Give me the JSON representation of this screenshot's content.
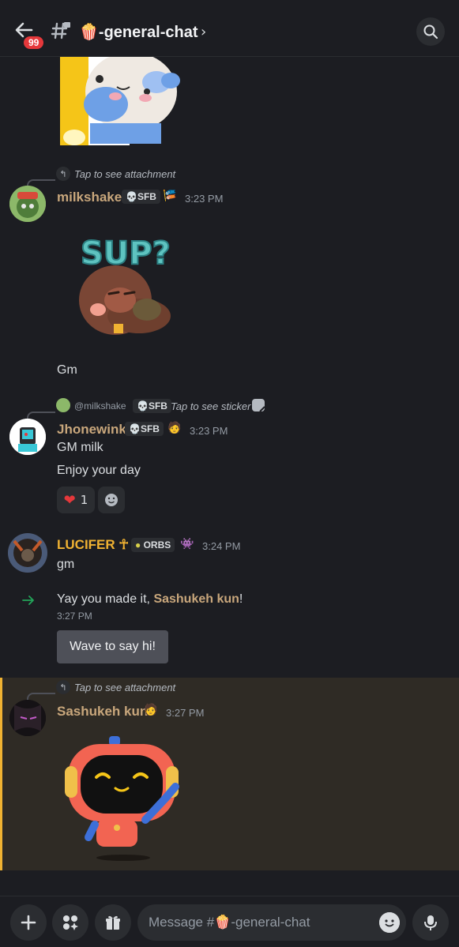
{
  "header": {
    "badge_count": "99",
    "channel_name": "🍿-general-chat",
    "chevron": "›"
  },
  "messages": {
    "reply1": {
      "text": "Tap to see attachment"
    },
    "m1": {
      "username": "milkshake",
      "tag": "SFB",
      "time": "3:23 PM",
      "text": "Gm"
    },
    "reply2": {
      "mention": "@milkshake",
      "tag": "SFB",
      "text": "Tap to see sticker"
    },
    "m2": {
      "username": "Jhonewink",
      "tag": "SFB",
      "time": "3:23 PM",
      "text1": "GM milk",
      "text2": "Enjoy your day",
      "reaction_count": "1"
    },
    "m3": {
      "username": "LUCIFER ☥",
      "tag": "ORBS",
      "time": "3:24 PM",
      "text": "gm"
    },
    "join": {
      "prefix": "Yay you made it, ",
      "name": "Sashukeh kun",
      "suffix": "!",
      "time": "3:27 PM",
      "wave_label": "Wave to say hi!"
    },
    "reply3": {
      "text": "Tap to see attachment"
    },
    "m4": {
      "username": "Sashukeh kun",
      "time": "3:27 PM"
    }
  },
  "composer": {
    "placeholder": "Message #🍿-general-chat"
  },
  "colors": {
    "background": "#1c1d22",
    "tan_username": "#c9a77c",
    "gold_username": "#f0b232",
    "highlight": "#2f2b25"
  }
}
